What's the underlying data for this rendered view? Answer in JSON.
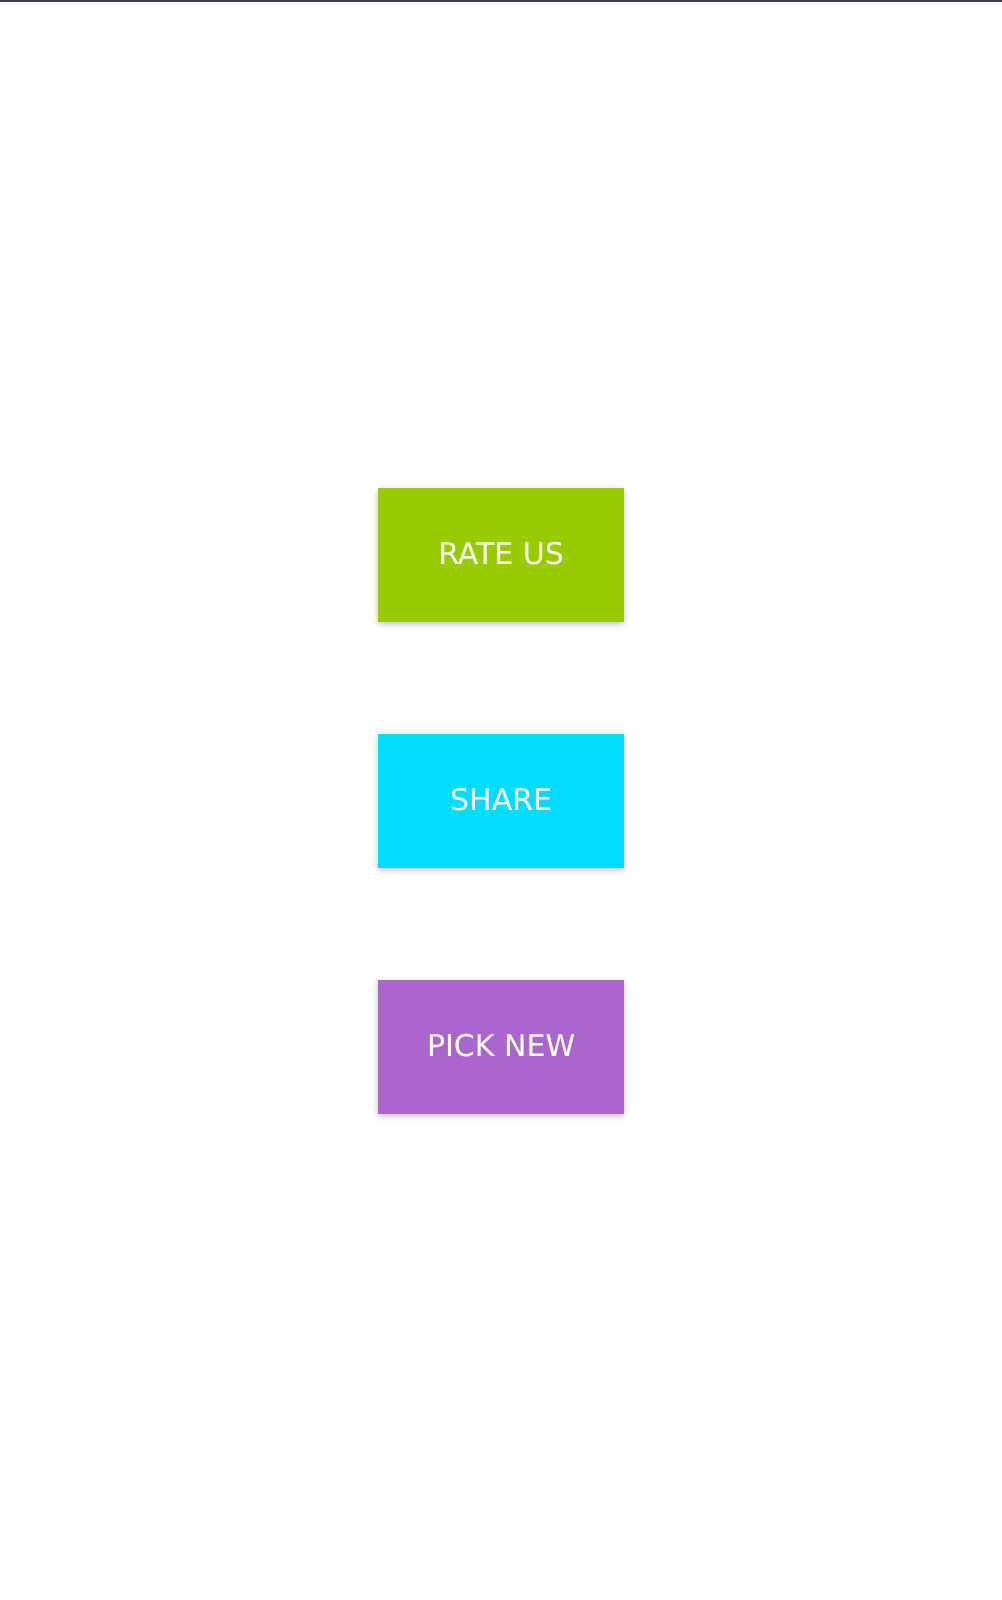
{
  "buttons": [
    {
      "label": "RATE US",
      "color": "#99cc00"
    },
    {
      "label": "SHARE",
      "color": "#00ddff"
    },
    {
      "label": "PICK NEW",
      "color": "#aa66cc"
    }
  ]
}
